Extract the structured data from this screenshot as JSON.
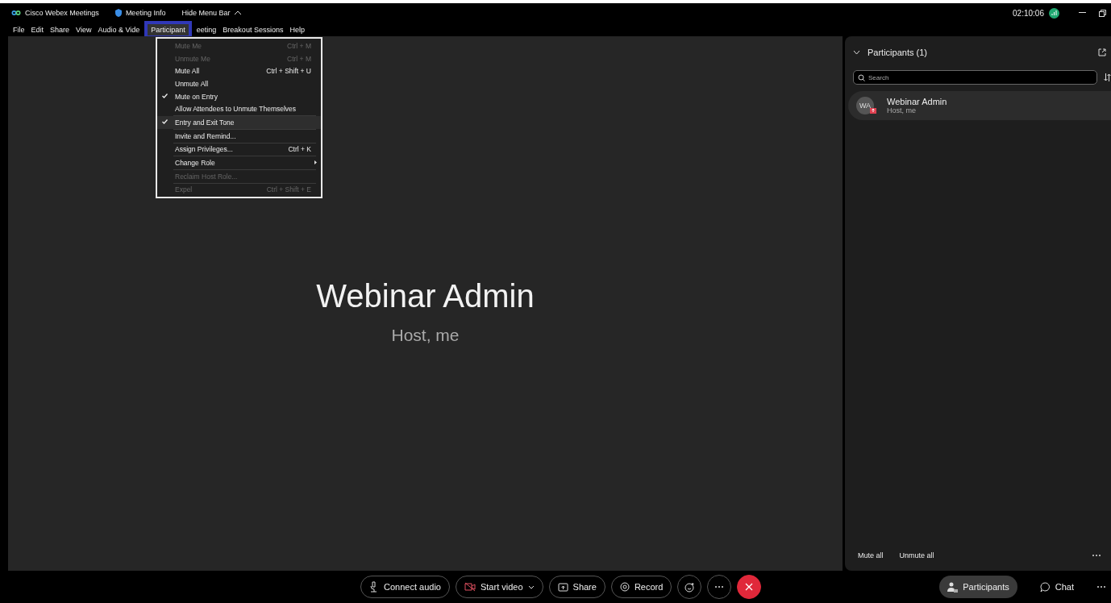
{
  "title_bar": {
    "app_name": "Cisco Webex Meetings",
    "meeting_info": "Meeting Info",
    "hide_menu": "Hide Menu Bar",
    "clock": "02:10:06"
  },
  "menu_bar": [
    {
      "label": "File",
      "selected": false
    },
    {
      "label": "Edit",
      "selected": false
    },
    {
      "label": "Share",
      "selected": false
    },
    {
      "label": "View",
      "selected": false
    },
    {
      "label": "Audio & Vide",
      "selected": false
    },
    {
      "label": "Participant",
      "selected": true
    },
    {
      "label": "eeting",
      "selected": false
    },
    {
      "label": "Breakout Sessions",
      "selected": false
    },
    {
      "label": "Help",
      "selected": false
    }
  ],
  "dropdown": {
    "groups": [
      [
        {
          "label": "Mute Me",
          "shortcut": "Ctrl + M",
          "disabled": true,
          "checked": false,
          "selected": false
        },
        {
          "label": "Unmute Me",
          "shortcut": "Ctrl + M",
          "disabled": true,
          "checked": false,
          "selected": false
        },
        {
          "label": "Mute All",
          "shortcut": "Ctrl + Shift + U",
          "disabled": false,
          "checked": false,
          "selected": false
        },
        {
          "label": "Unmute All",
          "disabled": false,
          "checked": false,
          "selected": false
        },
        {
          "label": "Mute on Entry",
          "disabled": false,
          "checked": true,
          "selected": false
        },
        {
          "label": "Allow Attendees to Unmute Themselves",
          "disabled": false,
          "checked": false,
          "selected": false
        }
      ],
      [
        {
          "label": "Entry and Exit Tone",
          "disabled": false,
          "checked": true,
          "selected": true
        }
      ],
      [
        {
          "label": "Invite and Remind...",
          "disabled": false,
          "checked": false,
          "selected": false
        }
      ],
      [
        {
          "label": "Assign Privileges...",
          "shortcut": "Ctrl + K",
          "disabled": false,
          "checked": false,
          "selected": false
        }
      ],
      [
        {
          "label": "Change Role",
          "disabled": false,
          "checked": false,
          "selected": false,
          "kind": "submenu"
        }
      ],
      [
        {
          "label": "Reclaim Host Role...",
          "disabled": true,
          "checked": false,
          "selected": false
        }
      ],
      [
        {
          "label": "Expel",
          "shortcut": "Ctrl + Shift + E",
          "disabled": true,
          "checked": false,
          "selected": false
        }
      ]
    ]
  },
  "stage": {
    "name": "Webinar Admin",
    "role": "Host, me"
  },
  "participants_panel": {
    "title": "Participants (1)",
    "search": {
      "placeholder": "Search"
    },
    "participants": [
      {
        "initials": "WA",
        "name": "Webinar Admin",
        "role": "Host, me",
        "selected": true
      }
    ],
    "actions": [
      "Mute all",
      "Unmute all"
    ]
  },
  "toolbar": [
    {
      "kind": "audio",
      "label": "Connect audio"
    },
    {
      "kind": "video",
      "label": "Start video"
    },
    {
      "kind": "share",
      "label": "Share"
    },
    {
      "kind": "record",
      "label": "Record"
    },
    {
      "kind": "reactions"
    },
    {
      "kind": "more"
    },
    {
      "kind": "leave"
    }
  ],
  "side_toolbar": [
    {
      "kind": "participants",
      "label": "Participants",
      "selected": true
    },
    {
      "kind": "chat",
      "label": "Chat",
      "selected": false
    }
  ]
}
